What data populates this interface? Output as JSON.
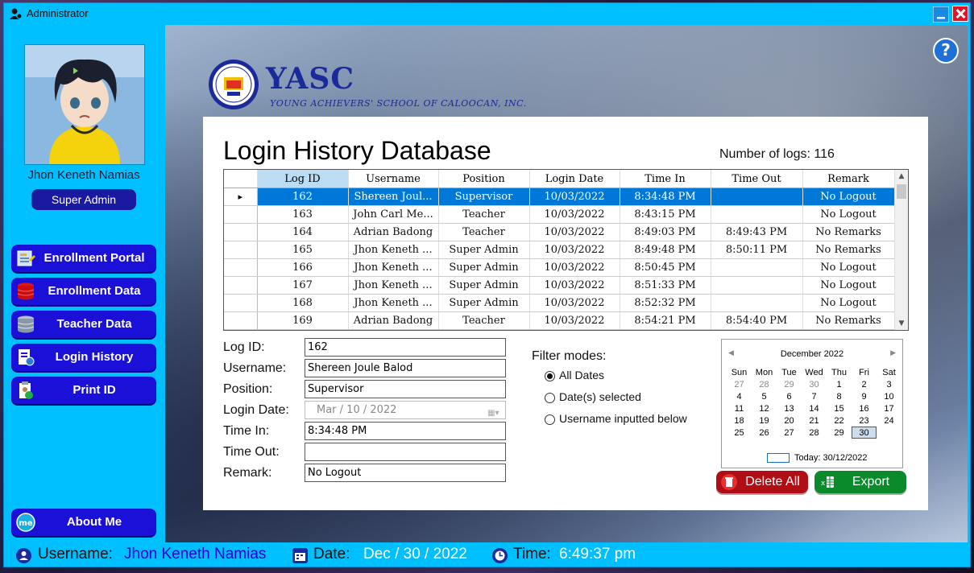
{
  "window": {
    "title": "Administrator"
  },
  "sidebar": {
    "user_fullname": "Jhon Keneth Namias",
    "role": "Super Admin",
    "nav": [
      {
        "label": "Enrollment Portal"
      },
      {
        "label": "Enrollment Data"
      },
      {
        "label": "Teacher Data"
      },
      {
        "label": "Login History"
      },
      {
        "label": "Print ID"
      }
    ],
    "about": "About Me"
  },
  "brand": {
    "name": "YASC",
    "subtitle": "YOUNG ACHIEVERS' SCHOOL OF CALOOCAN, INC."
  },
  "page": {
    "title": "Login History Database",
    "log_count": "Number of logs: 116"
  },
  "grid": {
    "columns": [
      "Log ID",
      "Username",
      "Position",
      "Login Date",
      "Time In",
      "Time Out",
      "Remark"
    ],
    "rows": [
      [
        "162",
        "Shereen Joul...",
        "Supervisor",
        "10/03/2022",
        "8:34:48 PM",
        "",
        "No Logout"
      ],
      [
        "163",
        "John Carl Me...",
        "Teacher",
        "10/03/2022",
        "8:43:15 PM",
        "",
        "No Logout"
      ],
      [
        "164",
        "Adrian Badong",
        "Teacher",
        "10/03/2022",
        "8:49:03 PM",
        "8:49:43 PM",
        "No Remarks"
      ],
      [
        "165",
        "Jhon Keneth ...",
        "Super Admin",
        "10/03/2022",
        "8:49:48 PM",
        "8:50:11 PM",
        "No Remarks"
      ],
      [
        "166",
        "Jhon Keneth ...",
        "Super Admin",
        "10/03/2022",
        "8:50:45 PM",
        "",
        "No Logout"
      ],
      [
        "167",
        "Jhon Keneth ...",
        "Super Admin",
        "10/03/2022",
        "8:51:33 PM",
        "",
        "No Logout"
      ],
      [
        "168",
        "Jhon Keneth ...",
        "Super Admin",
        "10/03/2022",
        "8:52:32 PM",
        "",
        "No Logout"
      ],
      [
        "169",
        "Adrian Badong",
        "Teacher",
        "10/03/2022",
        "8:54:21 PM",
        "8:54:40 PM",
        "No Remarks"
      ]
    ],
    "selected_row": 0
  },
  "details": {
    "log_id_label": "Log ID:",
    "log_id": "162",
    "username_label": "Username:",
    "username": "Shereen Joule Balod",
    "position_label": "Position:",
    "position": "Supervisor",
    "login_date_label": "Login Date:",
    "login_date": "Mar  /  10  /  2022",
    "time_in_label": "Time In:",
    "time_in": "8:34:48 PM",
    "time_out_label": "Time Out:",
    "time_out": "",
    "remark_label": "Remark:",
    "remark": "No Logout"
  },
  "filter": {
    "title": "Filter modes:",
    "options": [
      "All Dates",
      "Date(s) selected",
      "Username inputted below"
    ],
    "selected": 0
  },
  "calendar": {
    "month": "December 2022",
    "weekdays": [
      "Sun",
      "Mon",
      "Tue",
      "Wed",
      "Thu",
      "Fri",
      "Sat"
    ],
    "weeks": [
      [
        "27",
        "28",
        "29",
        "30",
        "1",
        "2",
        "3"
      ],
      [
        "4",
        "5",
        "6",
        "7",
        "8",
        "9",
        "10"
      ],
      [
        "11",
        "12",
        "13",
        "14",
        "15",
        "16",
        "17"
      ],
      [
        "18",
        "19",
        "20",
        "21",
        "22",
        "23",
        "24"
      ],
      [
        "25",
        "26",
        "27",
        "28",
        "29",
        "30",
        ""
      ]
    ],
    "today_label": "Today: 30/12/2022"
  },
  "actions": {
    "delete": "Delete All",
    "export": "Export"
  },
  "status": {
    "username_label": "Username:",
    "username": "Jhon Keneth Namias",
    "date_label": "Date:",
    "date": "Dec / 30 / 2022",
    "time_label": "Time:",
    "time": "6:49:37 pm"
  },
  "colors": {
    "frame": "#00bfff",
    "nav_button": "#1a10d8",
    "selected_row": "#0078d7",
    "brand": "#1a2a9a"
  }
}
